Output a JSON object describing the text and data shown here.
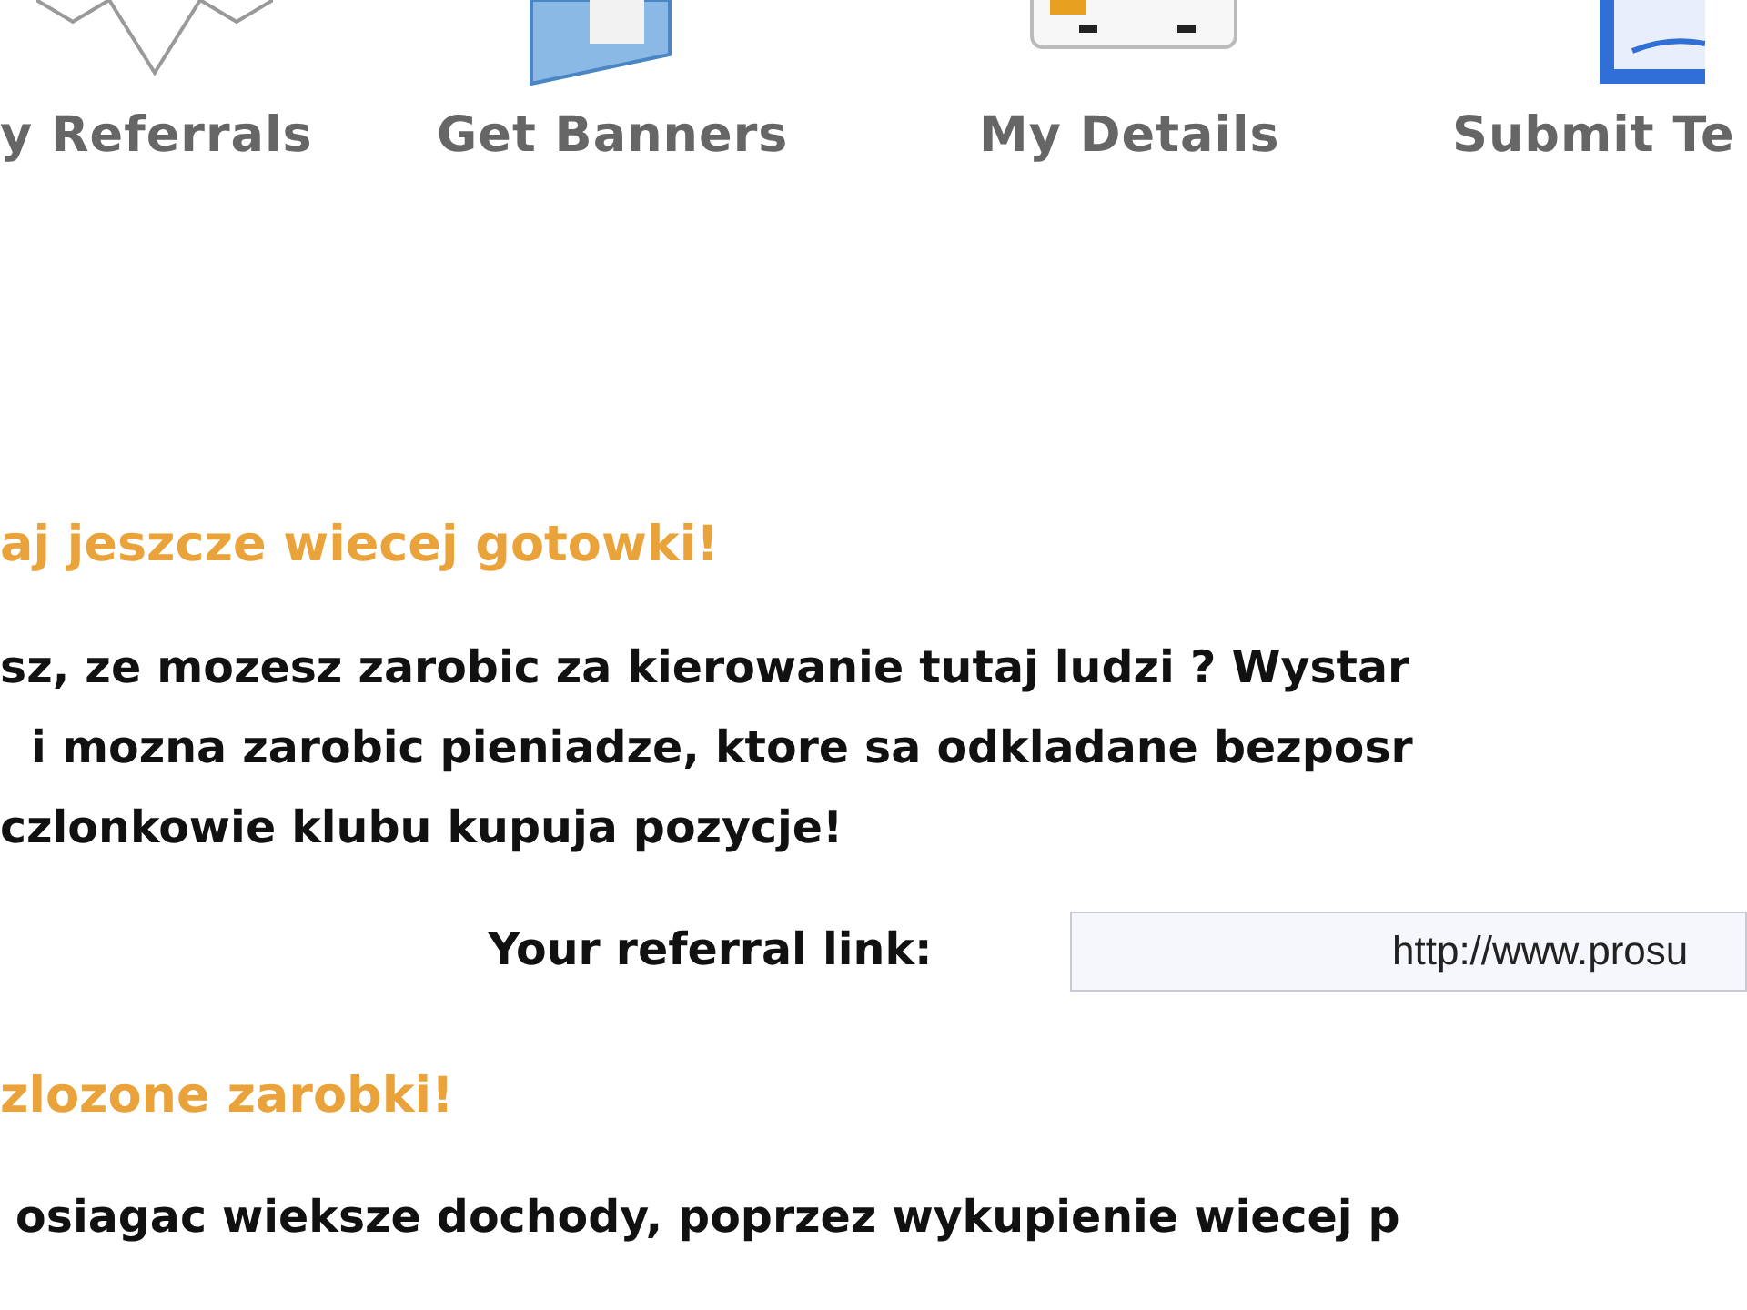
{
  "nav_items": [
    {
      "label": "y Referrals",
      "kind": "referrals"
    },
    {
      "label": "Get Banners",
      "kind": "banners"
    },
    {
      "label": "My Details",
      "kind": "details"
    },
    {
      "label": "Submit Te",
      "kind": "submit"
    }
  ],
  "sections": [
    {
      "heading": "aj jeszcze wiecej gotowki!",
      "lines": [
        "sz, ze mozesz zarobic za kierowanie tutaj ludzi ? Wystar",
        "  i mozna zarobic pieniadze, ktore sa odkladane bezposr",
        "czlonkowie klubu kupuja pozycje!"
      ],
      "referral": {
        "label": "Your referral link:",
        "value": "http://www.prosu"
      }
    },
    {
      "heading": "zlozone zarobki!",
      "lines": [
        " osiagac wieksze dochody, poprzez wykupienie wiecej p"
      ]
    }
  ]
}
